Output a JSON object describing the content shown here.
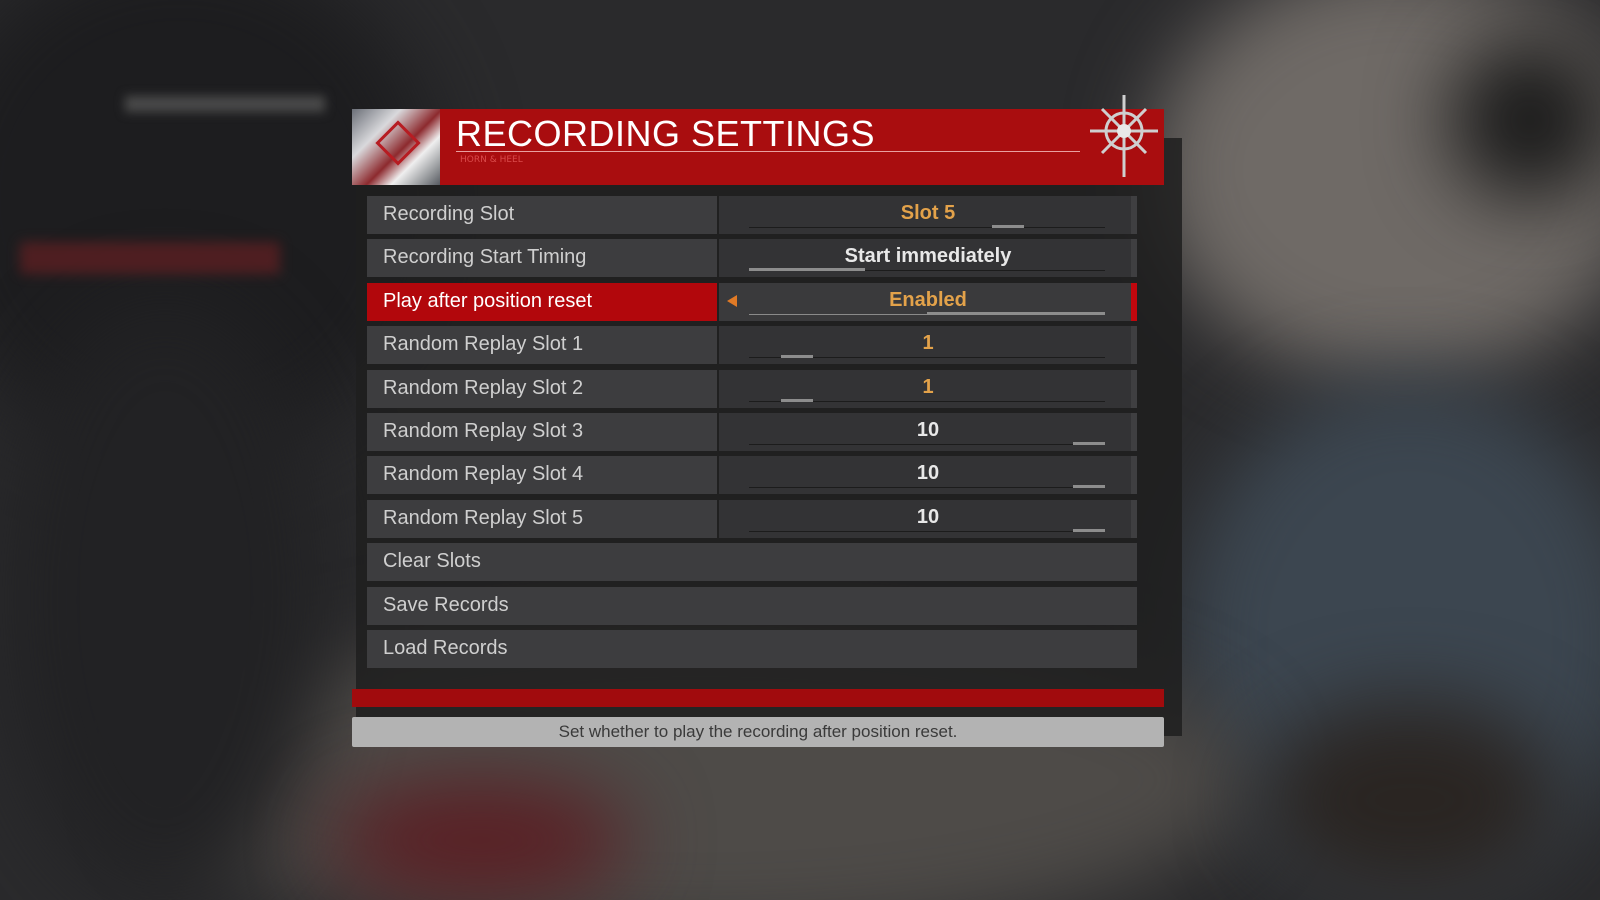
{
  "header": {
    "title": "RECORDING SETTINGS",
    "subtitle": "HORN & HEEL"
  },
  "rows": [
    {
      "label": "Recording Slot",
      "value": "Slot 5",
      "value_color": "#e3a24a",
      "slider_level": 0.75
    },
    {
      "label": "Recording Start Timing",
      "value": "Start immediately",
      "value_color": "#e8e8e8",
      "slider_level": 0.0
    },
    {
      "label": "Play after position reset",
      "value": "Enabled",
      "value_color": "#e3a24a",
      "slider_level": 1.0,
      "selected": true
    },
    {
      "label": "Random Replay Slot 1",
      "value": "1",
      "value_color": "#e3a24a",
      "slider_level": 0.1
    },
    {
      "label": "Random Replay Slot 2",
      "value": "1",
      "value_color": "#e3a24a",
      "slider_level": 0.1
    },
    {
      "label": "Random Replay Slot 3",
      "value": "10",
      "value_color": "#e8e8e8",
      "slider_level": 1.0
    },
    {
      "label": "Random Replay Slot 4",
      "value": "10",
      "value_color": "#e8e8e8",
      "slider_level": 1.0
    },
    {
      "label": "Random Replay Slot 5",
      "value": "10",
      "value_color": "#e8e8e8",
      "slider_level": 1.0
    }
  ],
  "actions": [
    {
      "label": "Clear Slots"
    },
    {
      "label": "Save Records"
    },
    {
      "label": "Load Records"
    }
  ],
  "help_text": "Set whether to play the recording after position reset.",
  "colors": {
    "accent_red": "#a90d0f",
    "value_gold": "#e3a24a"
  }
}
